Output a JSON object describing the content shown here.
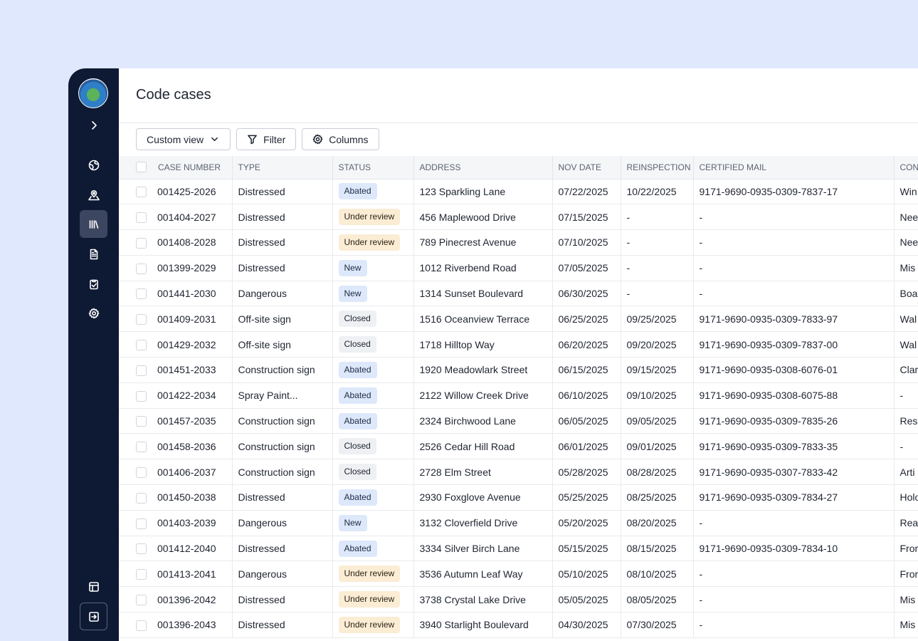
{
  "page": {
    "title": "Code cases"
  },
  "toolbar": {
    "custom_view_label": "Custom view",
    "filter_label": "Filter",
    "columns_label": "Columns"
  },
  "sidebar": {
    "items": [
      {
        "name": "expand",
        "icon": "chevron-right-icon"
      },
      {
        "name": "dashboard",
        "icon": "globe-icon"
      },
      {
        "name": "map",
        "icon": "map-pin-icon"
      },
      {
        "name": "library",
        "icon": "library-icon",
        "active": true
      },
      {
        "name": "documents",
        "icon": "document-icon"
      },
      {
        "name": "tasks",
        "icon": "clipboard-check-icon"
      },
      {
        "name": "settings",
        "icon": "gear-icon"
      },
      {
        "name": "layout",
        "icon": "layout-icon"
      },
      {
        "name": "logout",
        "icon": "logout-icon"
      }
    ]
  },
  "table": {
    "headers": [
      "CASE NUMBER",
      "TYPE",
      "STATUS",
      "ADDRESS",
      "NOV DATE",
      "REINSPECTION",
      "CERTIFIED MAIL",
      "CON"
    ],
    "rows": [
      [
        "001425-2026",
        "Distressed",
        "Abated",
        "123 Sparkling Lane",
        "07/22/2025",
        "10/22/2025",
        "9171-9690-0935-0309-7837-17",
        "Win"
      ],
      [
        "001404-2027",
        "Distressed",
        "Under review",
        "456 Maplewood Drive",
        "07/15/2025",
        "-",
        "-",
        "Nee"
      ],
      [
        "001408-2028",
        "Distressed",
        "Under review",
        "789 Pinecrest Avenue",
        "07/10/2025",
        "-",
        "-",
        "Nee"
      ],
      [
        "001399-2029",
        "Distressed",
        "New",
        "1012 Riverbend Road",
        "07/05/2025",
        "-",
        "-",
        "Mis"
      ],
      [
        "001441-2030",
        "Dangerous",
        "New",
        "1314 Sunset Boulevard",
        "06/30/2025",
        "-",
        "-",
        "Boa"
      ],
      [
        "001409-2031",
        "Off-site sign",
        "Closed",
        "1516 Oceanview Terrace",
        "06/25/2025",
        "09/25/2025",
        "9171-9690-0935-0309-7833-97",
        "Wal"
      ],
      [
        "001429-2032",
        "Off-site sign",
        "Closed",
        "1718 Hilltop Way",
        "06/20/2025",
        "09/20/2025",
        "9171-9690-0935-0309-7837-00",
        "Wal"
      ],
      [
        "001451-2033",
        "Construction sign",
        "Abated",
        "1920 Meadowlark Street",
        "06/15/2025",
        "09/15/2025",
        "9171-9690-0935-0308-6076-01",
        "Clar"
      ],
      [
        "001422-2034",
        "Spray Paint...",
        "Abated",
        "2122 Willow Creek Drive",
        "06/10/2025",
        "09/10/2025",
        "9171-9690-0935-0308-6075-88",
        "-"
      ],
      [
        "001457-2035",
        "Construction sign",
        "Abated",
        "2324 Birchwood Lane",
        "06/05/2025",
        "09/05/2025",
        "9171-9690-0935-0309-7835-26",
        "Res"
      ],
      [
        "001458-2036",
        "Construction sign",
        "Closed",
        "2526 Cedar Hill Road",
        "06/01/2025",
        "09/01/2025",
        "9171-9690-0935-0309-7833-35",
        "-"
      ],
      [
        "001406-2037",
        "Construction sign",
        "Closed",
        "2728 Elm Street",
        "05/28/2025",
        "08/28/2025",
        "9171-9690-0935-0307-7833-42",
        "Arti"
      ],
      [
        "001450-2038",
        "Distressed",
        "Abated",
        "2930 Foxglove Avenue",
        "05/25/2025",
        "08/25/2025",
        "9171-9690-0935-0309-7834-27",
        "Holo"
      ],
      [
        "001403-2039",
        "Dangerous",
        "New",
        "3132 Cloverfield Drive",
        "05/20/2025",
        "08/20/2025",
        "-",
        "Rea"
      ],
      [
        "001412-2040",
        "Distressed",
        "Abated",
        "3334 Silver Birch Lane",
        "05/15/2025",
        "08/15/2025",
        "9171-9690-0935-0309-7834-10",
        "Fror"
      ],
      [
        "001413-2041",
        "Dangerous",
        "Under review",
        "3536 Autumn Leaf Way",
        "05/10/2025",
        "08/10/2025",
        "-",
        "Fror"
      ],
      [
        "001396-2042",
        "Distressed",
        "Under review",
        "3738 Crystal Lake Drive",
        "05/05/2025",
        "08/05/2025",
        "-",
        "Mis"
      ],
      [
        "001396-2043",
        "Distressed",
        "Under review",
        "3940 Starlight Boulevard",
        "04/30/2025",
        "07/30/2025",
        "-",
        "Mis"
      ]
    ]
  },
  "colors": {
    "sidebar_bg": "#0e1a33",
    "page_bg": "#e0e8fd",
    "badge_abated": "#dde8fb",
    "badge_under_review": "#fbecd4",
    "badge_new": "#dde8fb",
    "badge_closed": "#eef0f3"
  }
}
